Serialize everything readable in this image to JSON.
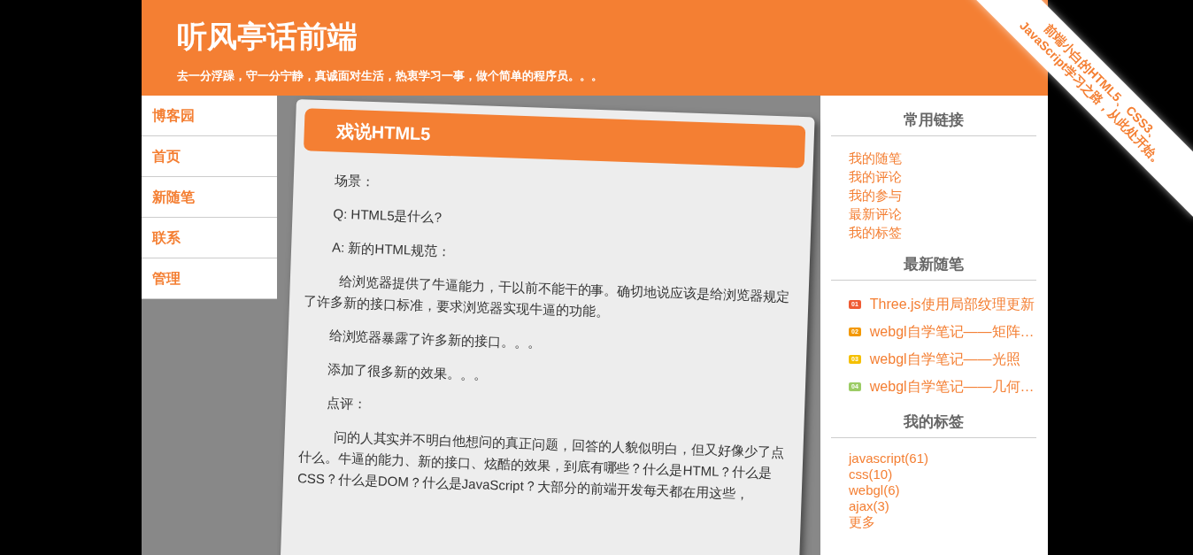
{
  "header": {
    "title": "听风亭话前端",
    "subtitle": "去一分浮躁，守一分宁静，真诚面对生活，热衷学习一事，做个简单的程序员。。。"
  },
  "ribbon": {
    "lines": [
      "前端小白的HTML5、CSS3、",
      "JavaScript学习之路，从此处开始。"
    ]
  },
  "nav": {
    "items": [
      {
        "label": "博客园"
      },
      {
        "label": "首页"
      },
      {
        "label": "新随笔"
      },
      {
        "label": "联系"
      },
      {
        "label": "管理"
      }
    ]
  },
  "article": {
    "title": "戏说HTML5",
    "paragraphs": [
      {
        "text": "场景：",
        "indent": false
      },
      {
        "text": "Q: HTML5是什么?",
        "indent": false
      },
      {
        "text": "A: 新的HTML规范：",
        "indent": false
      },
      {
        "text": "给浏览器提供了牛逼能力，干以前不能干的事。确切地说应该是给浏览器规定了许多新的接口标准，要求浏览器实现牛逼的功能。",
        "indent": true
      },
      {
        "text": "给浏览器暴露了许多新的接口。。。",
        "indent": false
      },
      {
        "text": "添加了很多新的效果。。。",
        "indent": false
      },
      {
        "text": "点评：",
        "indent": false
      },
      {
        "text": "问的人其实并不明白他想问的真正问题，回答的人貌似明白，但又好像少了点什么。牛逼的能力、新的接口、炫酷的效果，到底有哪些？什么是HTML？什么是CSS？什么是DOM？什么是JavaScript？大部分的前端开发每天都在用这些，",
        "indent": true
      }
    ]
  },
  "sidebar": {
    "sections": [
      {
        "title": "常用链接",
        "kind": "links",
        "items": [
          {
            "label": "我的随笔"
          },
          {
            "label": "我的评论"
          },
          {
            "label": "我的参与"
          },
          {
            "label": "最新评论"
          },
          {
            "label": "我的标签"
          }
        ]
      },
      {
        "title": "最新随笔",
        "kind": "ranked",
        "items": [
          {
            "rank": "01",
            "label": "Three.js使用局部纹理更新",
            "color": "#ef5b34"
          },
          {
            "rank": "02",
            "label": "webgl自学笔记——矩阵…",
            "color": "#f39800"
          },
          {
            "rank": "03",
            "label": "webgl自学笔记——光照",
            "color": "#f5c000"
          },
          {
            "rank": "04",
            "label": "webgl自学笔记——几何…",
            "color": "#9ccc65"
          }
        ]
      },
      {
        "title": "我的标签",
        "kind": "tags",
        "items": [
          {
            "label": "javascript(61)"
          },
          {
            "label": "css(10)"
          },
          {
            "label": "webgl(6)"
          },
          {
            "label": "ajax(3)"
          },
          {
            "label": "更多"
          }
        ]
      }
    ]
  }
}
